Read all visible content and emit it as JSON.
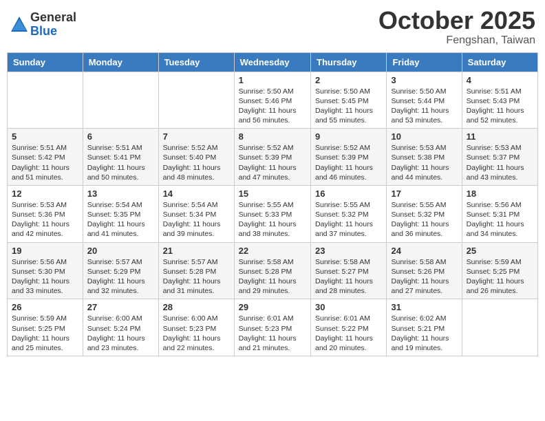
{
  "logo": {
    "general": "General",
    "blue": "Blue"
  },
  "header": {
    "month": "October 2025",
    "location": "Fengshan, Taiwan"
  },
  "days_of_week": [
    "Sunday",
    "Monday",
    "Tuesday",
    "Wednesday",
    "Thursday",
    "Friday",
    "Saturday"
  ],
  "weeks": [
    [
      {
        "day": "",
        "info": ""
      },
      {
        "day": "",
        "info": ""
      },
      {
        "day": "",
        "info": ""
      },
      {
        "day": "1",
        "info": "Sunrise: 5:50 AM\nSunset: 5:46 PM\nDaylight: 11 hours and 56 minutes."
      },
      {
        "day": "2",
        "info": "Sunrise: 5:50 AM\nSunset: 5:45 PM\nDaylight: 11 hours and 55 minutes."
      },
      {
        "day": "3",
        "info": "Sunrise: 5:50 AM\nSunset: 5:44 PM\nDaylight: 11 hours and 53 minutes."
      },
      {
        "day": "4",
        "info": "Sunrise: 5:51 AM\nSunset: 5:43 PM\nDaylight: 11 hours and 52 minutes."
      }
    ],
    [
      {
        "day": "5",
        "info": "Sunrise: 5:51 AM\nSunset: 5:42 PM\nDaylight: 11 hours and 51 minutes."
      },
      {
        "day": "6",
        "info": "Sunrise: 5:51 AM\nSunset: 5:41 PM\nDaylight: 11 hours and 50 minutes."
      },
      {
        "day": "7",
        "info": "Sunrise: 5:52 AM\nSunset: 5:40 PM\nDaylight: 11 hours and 48 minutes."
      },
      {
        "day": "8",
        "info": "Sunrise: 5:52 AM\nSunset: 5:39 PM\nDaylight: 11 hours and 47 minutes."
      },
      {
        "day": "9",
        "info": "Sunrise: 5:52 AM\nSunset: 5:39 PM\nDaylight: 11 hours and 46 minutes."
      },
      {
        "day": "10",
        "info": "Sunrise: 5:53 AM\nSunset: 5:38 PM\nDaylight: 11 hours and 44 minutes."
      },
      {
        "day": "11",
        "info": "Sunrise: 5:53 AM\nSunset: 5:37 PM\nDaylight: 11 hours and 43 minutes."
      }
    ],
    [
      {
        "day": "12",
        "info": "Sunrise: 5:53 AM\nSunset: 5:36 PM\nDaylight: 11 hours and 42 minutes."
      },
      {
        "day": "13",
        "info": "Sunrise: 5:54 AM\nSunset: 5:35 PM\nDaylight: 11 hours and 41 minutes."
      },
      {
        "day": "14",
        "info": "Sunrise: 5:54 AM\nSunset: 5:34 PM\nDaylight: 11 hours and 39 minutes."
      },
      {
        "day": "15",
        "info": "Sunrise: 5:55 AM\nSunset: 5:33 PM\nDaylight: 11 hours and 38 minutes."
      },
      {
        "day": "16",
        "info": "Sunrise: 5:55 AM\nSunset: 5:32 PM\nDaylight: 11 hours and 37 minutes."
      },
      {
        "day": "17",
        "info": "Sunrise: 5:55 AM\nSunset: 5:32 PM\nDaylight: 11 hours and 36 minutes."
      },
      {
        "day": "18",
        "info": "Sunrise: 5:56 AM\nSunset: 5:31 PM\nDaylight: 11 hours and 34 minutes."
      }
    ],
    [
      {
        "day": "19",
        "info": "Sunrise: 5:56 AM\nSunset: 5:30 PM\nDaylight: 11 hours and 33 minutes."
      },
      {
        "day": "20",
        "info": "Sunrise: 5:57 AM\nSunset: 5:29 PM\nDaylight: 11 hours and 32 minutes."
      },
      {
        "day": "21",
        "info": "Sunrise: 5:57 AM\nSunset: 5:28 PM\nDaylight: 11 hours and 31 minutes."
      },
      {
        "day": "22",
        "info": "Sunrise: 5:58 AM\nSunset: 5:28 PM\nDaylight: 11 hours and 29 minutes."
      },
      {
        "day": "23",
        "info": "Sunrise: 5:58 AM\nSunset: 5:27 PM\nDaylight: 11 hours and 28 minutes."
      },
      {
        "day": "24",
        "info": "Sunrise: 5:58 AM\nSunset: 5:26 PM\nDaylight: 11 hours and 27 minutes."
      },
      {
        "day": "25",
        "info": "Sunrise: 5:59 AM\nSunset: 5:25 PM\nDaylight: 11 hours and 26 minutes."
      }
    ],
    [
      {
        "day": "26",
        "info": "Sunrise: 5:59 AM\nSunset: 5:25 PM\nDaylight: 11 hours and 25 minutes."
      },
      {
        "day": "27",
        "info": "Sunrise: 6:00 AM\nSunset: 5:24 PM\nDaylight: 11 hours and 23 minutes."
      },
      {
        "day": "28",
        "info": "Sunrise: 6:00 AM\nSunset: 5:23 PM\nDaylight: 11 hours and 22 minutes."
      },
      {
        "day": "29",
        "info": "Sunrise: 6:01 AM\nSunset: 5:23 PM\nDaylight: 11 hours and 21 minutes."
      },
      {
        "day": "30",
        "info": "Sunrise: 6:01 AM\nSunset: 5:22 PM\nDaylight: 11 hours and 20 minutes."
      },
      {
        "day": "31",
        "info": "Sunrise: 6:02 AM\nSunset: 5:21 PM\nDaylight: 11 hours and 19 minutes."
      },
      {
        "day": "",
        "info": ""
      }
    ]
  ]
}
